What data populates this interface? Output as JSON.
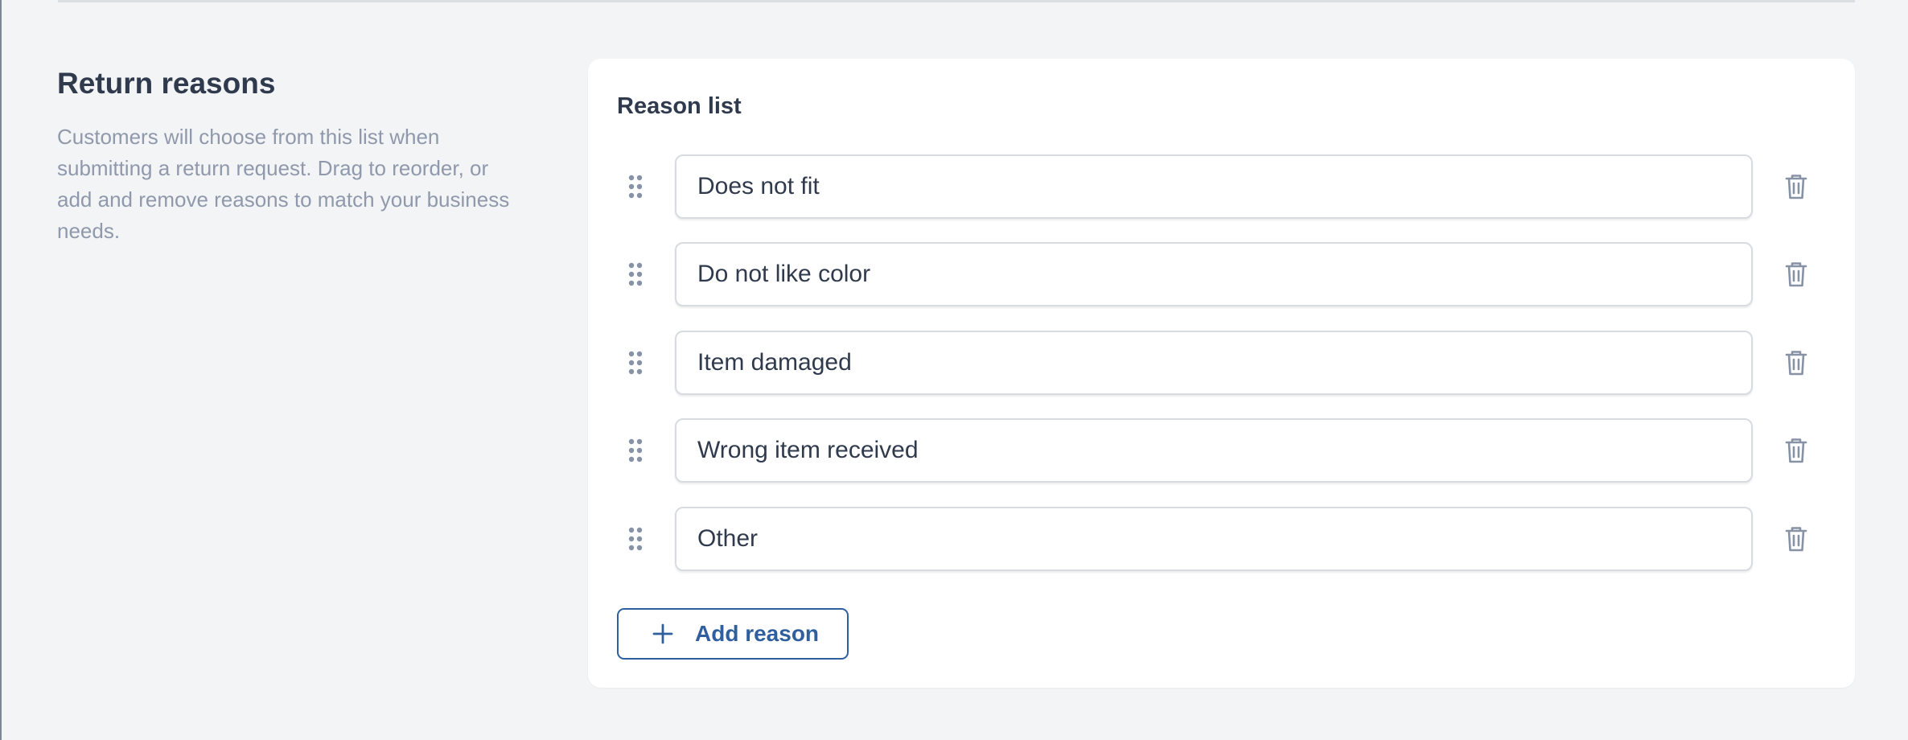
{
  "section": {
    "title": "Return reasons",
    "description": "Customers will choose from this list when submitting a return request. Drag to reorder, or add and remove reasons to match your business needs."
  },
  "card": {
    "title": "Reason list"
  },
  "reasons": [
    {
      "value": "Does not fit"
    },
    {
      "value": "Do not like color"
    },
    {
      "value": "Item damaged"
    },
    {
      "value": "Wrong item received"
    },
    {
      "value": "Other"
    }
  ],
  "actions": {
    "add_label": "Add reason"
  },
  "icons": {
    "drag": "drag-handle-icon",
    "delete": "trash-icon",
    "add": "plus-icon"
  },
  "colors": {
    "background": "#f3f4f6",
    "card": "#ffffff",
    "text": "#2f3a4d",
    "muted": "#8f99ab",
    "accent": "#2f5f9e",
    "icon": "#8792a5"
  }
}
